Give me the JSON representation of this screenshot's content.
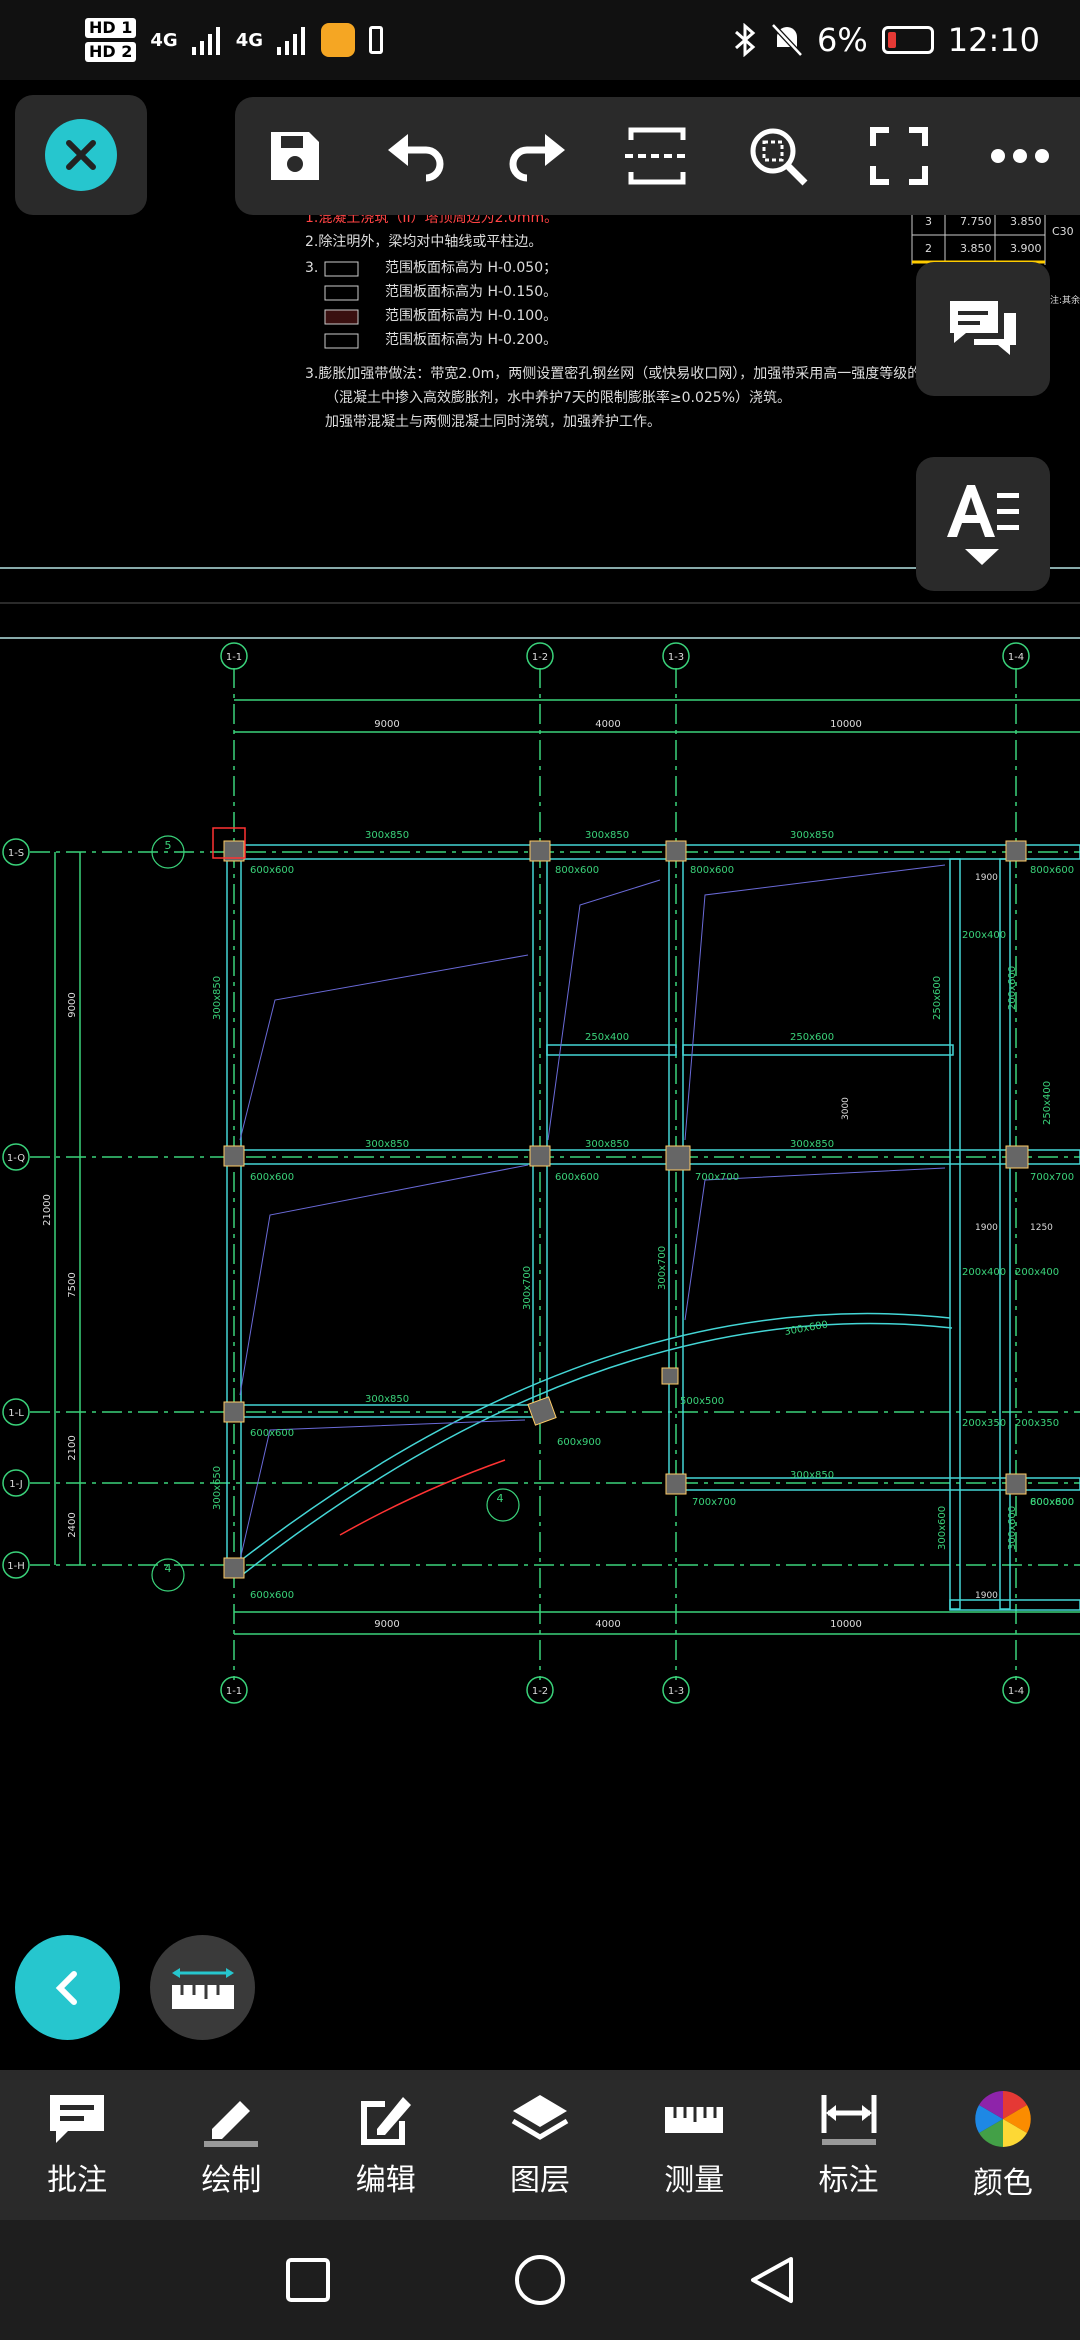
{
  "status": {
    "hd1": "HD 1",
    "hd2": "HD 2",
    "net1": "4G",
    "net2": "4G",
    "battery_pct": "6%",
    "time": "12:10"
  },
  "toolbar": {
    "items": [
      "close-icon",
      "save-icon",
      "undo-icon",
      "redo-icon",
      "region-icon",
      "zoom-region-icon",
      "fullscreen-icon",
      "more-icon"
    ]
  },
  "drawing": {
    "notes": [
      "1.混凝土浇筑（II）塔顶周边为2.0mm。",
      "2.除注明外，梁均对中轴线或平柱边。",
      "3.",
      "范围板面标高为 H-0.050；",
      "范围板面标高为 H-0.150。",
      "范围板面标高为 H-0.100。",
      "范围板面标高为 H-0.200。",
      "3.膨胀加强带做法：带宽2.0m，两侧设置密孔钢丝网（或快易收口网），加强带采用高一强度等级的膨胀混凝土",
      "（混凝土中掺入高效膨胀剂，水中养护7天的限制膨胀率≥0.025%）浇筑。",
      "加强带混凝土与两侧混凝土同时浇筑，加强养护工作。"
    ],
    "table": [
      [
        "3",
        "7.750",
        "3.850"
      ],
      [
        "2",
        "3.850",
        "3.900"
      ]
    ],
    "table_extra": [
      "C30",
      "注:其余"
    ],
    "axis_top": [
      "1-1",
      "1-2",
      "1-3",
      "1-4"
    ],
    "axis_left": [
      "1-S",
      "1-Q",
      "1-L",
      "1-J",
      "1-H"
    ],
    "dims_top": [
      "9000",
      "4000",
      "10000"
    ],
    "dims_left": [
      "9000",
      "7500",
      "2100",
      "2400"
    ],
    "dim_total_left": "21000",
    "beams": [
      "300x850",
      "300x850",
      "300x850",
      "300x850",
      "300x850",
      "300x850",
      "300x850",
      "300x850",
      "300x850",
      "300x700",
      "300x700",
      "300x650",
      "300x600",
      "300x600",
      "250x400",
      "250x600",
      "250x600",
      "250x400",
      "200x400",
      "200x400",
      "200x350",
      "200x350",
      "200x600",
      "200x400",
      "500x500",
      "300x600",
      "600x900",
      "700x700",
      "700x700",
      "800x600"
    ],
    "columns": [
      "600x600",
      "600x600",
      "800x600",
      "800x600",
      "600x600",
      "600x600",
      "800x600",
      "700x700",
      "600x600",
      "600x800"
    ],
    "misc_dims": [
      "1900",
      "1900",
      "1900",
      "1250",
      "3000"
    ],
    "section_tags": [
      "4",
      "4",
      "5"
    ]
  },
  "tabs": [
    {
      "icon": "comment-icon",
      "label": "批注"
    },
    {
      "icon": "pencil-icon",
      "label": "绘制"
    },
    {
      "icon": "edit-icon",
      "label": "编辑"
    },
    {
      "icon": "layers-icon",
      "label": "图层"
    },
    {
      "icon": "ruler-icon",
      "label": "测量"
    },
    {
      "icon": "dimension-icon",
      "label": "标注"
    },
    {
      "icon": "color-wheel-icon",
      "label": "颜色"
    }
  ],
  "colors": {
    "accent": "#26c6ce",
    "grid": "#3ad27a",
    "beam": "#44d6d6",
    "note_red": "#ff4444"
  }
}
